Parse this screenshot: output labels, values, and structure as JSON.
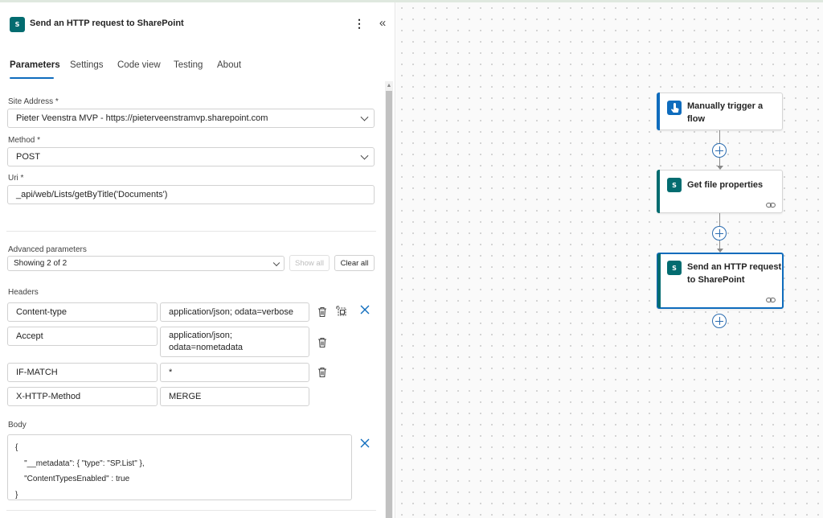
{
  "panel": {
    "title": "Send an HTTP request to SharePoint",
    "more_icon": "more-vertical-icon",
    "collapse_icon": "double-chevron-left-icon",
    "logo_text": "S",
    "tabs": [
      {
        "label": "Parameters",
        "active": true
      },
      {
        "label": "Settings",
        "active": false
      },
      {
        "label": "Code view",
        "active": false
      },
      {
        "label": "Testing",
        "active": false
      },
      {
        "label": "About",
        "active": false
      }
    ],
    "site_address": {
      "label": "Site Address *",
      "value": "Pieter Veenstra MVP - https://pieterveenstramvp.sharepoint.com"
    },
    "method": {
      "label": "Method *",
      "value": "POST"
    },
    "uri": {
      "label": "Uri *",
      "value": "_api/web/Lists/getByTitle('Documents')"
    },
    "advanced": {
      "label": "Advanced parameters",
      "value": "Showing 2 of 2",
      "show_all": "Show all",
      "clear_all": "Clear all"
    },
    "headers": {
      "label": "Headers",
      "rows": [
        {
          "key": "Content-type",
          "value": "application/json; odata=verbose"
        },
        {
          "key": "Accept",
          "value_line1": "application/json;",
          "value_line2": "odata=nometadata"
        },
        {
          "key": "IF-MATCH",
          "value": "*"
        },
        {
          "key": "X-HTTP-Method",
          "value": "MERGE"
        }
      ]
    },
    "body": {
      "label": "Body",
      "value": "{\n    \"__metadata\": { \"type\": \"SP.List\" },\n    \"ContentTypesEnabled\" : true\n}"
    }
  },
  "canvas": {
    "nodes": [
      {
        "title_line1": "Manually trigger a",
        "title_line2": "flow",
        "icon": "manual-trigger-icon",
        "accent": "#0f6cbd"
      },
      {
        "title": "Get file properties",
        "icon": "sharepoint-icon",
        "accent": "#036c70"
      },
      {
        "title_line1": "Send an HTTP request",
        "title_line2": "to SharePoint",
        "icon": "sharepoint-icon",
        "accent": "#036c70",
        "selected": true
      }
    ]
  },
  "colors": {
    "accent": "#0f6cbd",
    "sharepoint": "#036c70"
  }
}
